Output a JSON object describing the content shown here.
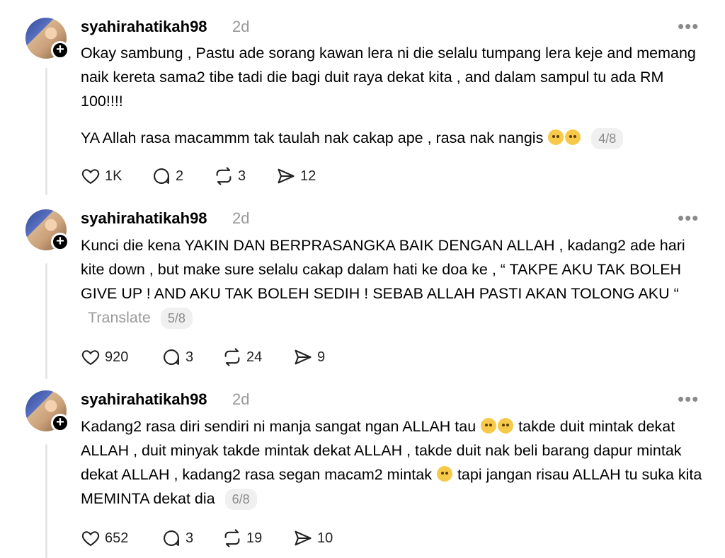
{
  "posts": [
    {
      "username": "syahirahatikah98",
      "time": "2d",
      "paragraphs": [
        "Okay sambung , Pastu ade sorang kawan lera ni die selalu tumpang lera keje and memang naik kereta sama2 tibe tadi die bagi duit raya dekat kita , and dalam sampul tu ada RM 100!!!!",
        "YA Allah rasa macammm tak taulah nak cakap ape , rasa nak nangis"
      ],
      "emoji": [
        "crying-face-emoji",
        "crying-face-emoji"
      ],
      "counter": "4/8",
      "likes": "1K",
      "comments": "2",
      "reposts": "3",
      "shares": "12"
    },
    {
      "username": "syahirahatikah98",
      "time": "2d",
      "paragraphs": [
        "Kunci die kena YAKIN DAN BERPRASANGKA BAIK DENGAN ALLAH , kadang2 ade hari kite down , but make sure selalu cakap dalam hati ke doa ke , “ TAKPE AKU TAK BOLEH GIVE UP ! AND AKU TAK BOLEH SEDIH ! SEBAB ALLAH PASTI AKAN TOLONG AKU “"
      ],
      "translate": "Translate",
      "counter": "5/8",
      "likes": "920",
      "comments": "3",
      "reposts": "24",
      "shares": "9"
    },
    {
      "username": "syahirahatikah98",
      "time": "2d",
      "paragraphs_a": "Kadang2 rasa diri sendiri ni manja sangat ngan ALLAH tau",
      "paragraphs_b": "takde duit mintak dekat ALLAH , duit minyak takde mintak dekat ALLAH , takde duit nak beli barang dapur mintak dekat ALLAH , kadang2 rasa segan macam2 mintak",
      "paragraphs_c": "tapi jangan risau ALLAH tu suka kita MEMINTA dekat dia",
      "counter": "6/8",
      "likes": "652",
      "comments": "3",
      "reposts": "19",
      "shares": "10"
    }
  ],
  "more_label": "•••"
}
